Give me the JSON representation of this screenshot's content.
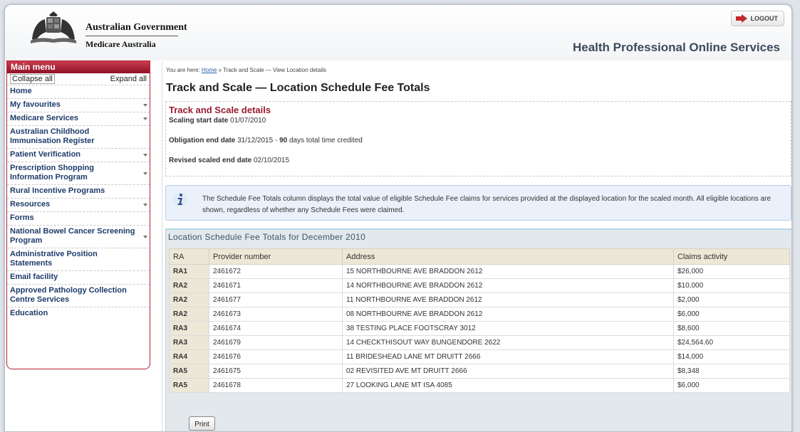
{
  "header": {
    "gov_name": "Australian Government",
    "gov_sub": "Medicare Australia",
    "logout_label": "LOGOUT",
    "portal_title": "Health Professional Online Services"
  },
  "sidebar": {
    "title": "Main menu",
    "collapse_all": "Collapse all",
    "expand_all": "Expand all",
    "items": [
      {
        "label": "Home",
        "has_submenu": false
      },
      {
        "label": "My favourites",
        "has_submenu": true
      },
      {
        "label": "Medicare Services",
        "has_submenu": true
      },
      {
        "label": "Australian Childhood Immunisation Register",
        "has_submenu": false
      },
      {
        "label": "Patient Verification",
        "has_submenu": true
      },
      {
        "label": "Prescription Shopping Information Program",
        "has_submenu": true
      },
      {
        "label": "Rural Incentive Programs",
        "has_submenu": false
      },
      {
        "label": "Resources",
        "has_submenu": true
      },
      {
        "label": "Forms",
        "has_submenu": false
      },
      {
        "label": "National Bowel Cancer Screening Program",
        "has_submenu": true
      },
      {
        "label": "Administrative Position Statements",
        "has_submenu": false
      },
      {
        "label": "Email facility",
        "has_submenu": false
      },
      {
        "label": "Approved Pathology Collection Centre Services",
        "has_submenu": false
      },
      {
        "label": "Education",
        "has_submenu": false
      }
    ]
  },
  "breadcrumb": {
    "prefix": "You are here: ",
    "home": "Home",
    "rest": " » Track and Scale — View Location details"
  },
  "page_title": "Track and Scale — Location Schedule Fee Totals",
  "details": {
    "heading": "Track and Scale details",
    "scaling_label": "Scaling start date",
    "scaling_value": "01/07/2010",
    "obligation_label": "Obligation end date",
    "obligation_value": "31/12/2015 -",
    "credited_days": "90",
    "credited_suffix": "days total time credited",
    "revised_label": "Revised scaled end date",
    "revised_value": "02/10/2015"
  },
  "info": {
    "icon": "info-icon",
    "text": "The Schedule Fee Totals column displays the total value of eligible Schedule Fee claims for services provided at the displayed location for the scaled month. All eligible locations are shown, regardless of whether any Schedule Fees were claimed."
  },
  "totals": {
    "title": "Location Schedule Fee Totals for December 2010",
    "columns": [
      "RA",
      "Provider number",
      "Address",
      "Claims activity"
    ],
    "rows": [
      [
        "RA1",
        "2461672",
        "15 NORTHBOURNE AVE BRADDON 2612",
        "$26,000"
      ],
      [
        "RA2",
        "2461671",
        "14 NORTHBOURNE AVE BRADDON 2612",
        "$10,000"
      ],
      [
        "RA2",
        "2461677",
        "11 NORTHBOURNE AVE BRADDON 2612",
        "$2,000"
      ],
      [
        "RA2",
        "2461673",
        "08 NORTHBOURNE AVE BRADDON 2612",
        "$6,000"
      ],
      [
        "RA3",
        "2461674",
        "38 TESTING PLACE FOOTSCRAY 3012",
        "$8,600"
      ],
      [
        "RA3",
        "2461679",
        "14 CHECKTHISOUT WAY BUNGENDORE 2622",
        "$24,564.60"
      ],
      [
        "RA4",
        "2461676",
        "11 BRIDESHEAD LANE MT DRUITT 2666",
        "$14,000"
      ],
      [
        "RA5",
        "2461675",
        "02 REVISITED AVE MT DRUITT 2666",
        "$8,348"
      ],
      [
        "RA5",
        "2461678",
        "27 LOOKING LANE MT ISA 4085",
        "$6,000"
      ]
    ],
    "print_label": "Print"
  },
  "colors": {
    "brand_red": "#9b1b30",
    "menu_link": "#1d3b6b",
    "header_cell": "#ece7d6"
  }
}
